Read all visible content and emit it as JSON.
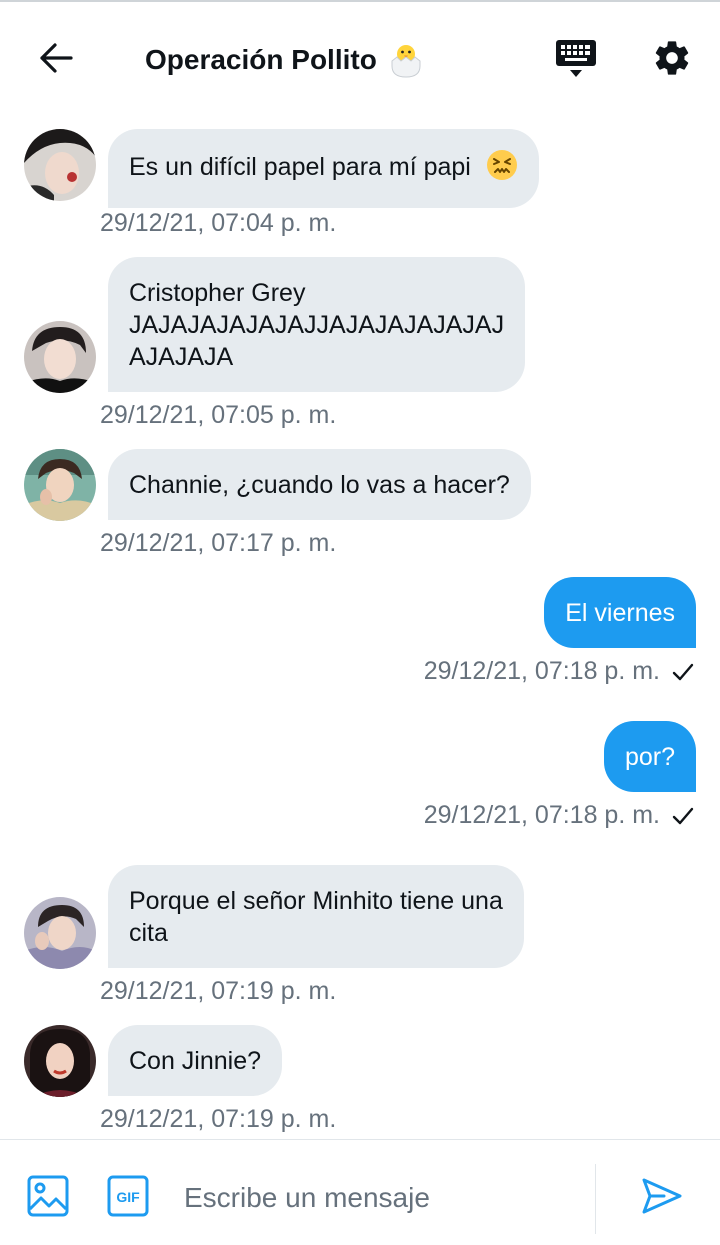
{
  "header": {
    "title": "Operación Pollito",
    "title_emoji_icon": "hatching-chick-icon",
    "back_icon": "arrow-left-icon",
    "keyboard_icon": "keyboard-icon",
    "settings_icon": "gear-icon"
  },
  "colors": {
    "accent": "#1d9bf0",
    "incoming_bubble": "#e6ebef",
    "timestamp": "#66717c",
    "text": "#0f1419"
  },
  "messages": [
    {
      "direction": "in",
      "text": "Es un difícil papel para mí papi",
      "emoji_icon": "confounded-face-icon",
      "timestamp": "29/12/21, 07:04 p. m."
    },
    {
      "direction": "in",
      "text": "Cristopher Grey\nJAJAJAJAJAJAJJAJAJAJAJAJAJ\nAJAJAJA",
      "timestamp": "29/12/21, 07:05 p. m."
    },
    {
      "direction": "in",
      "text": "Channie, ¿cuando lo vas a hacer?",
      "timestamp": "29/12/21, 07:17 p. m."
    },
    {
      "direction": "out",
      "text": "El viernes",
      "timestamp": "29/12/21, 07:18 p. m.",
      "status_icon": "check-icon"
    },
    {
      "direction": "out",
      "text": "por?",
      "timestamp": "29/12/21, 07:18 p. m.",
      "status_icon": "check-icon"
    },
    {
      "direction": "in",
      "text": "Porque el señor Minhito tiene una\ncita",
      "timestamp": "29/12/21, 07:19 p. m."
    },
    {
      "direction": "in",
      "text": "Con Jinnie?",
      "timestamp": "29/12/21, 07:19 p. m."
    }
  ],
  "composer": {
    "placeholder": "Escribe un mensaje",
    "value": "",
    "image_icon": "image-icon",
    "gif_icon": "gif-icon",
    "send_icon": "send-icon"
  }
}
